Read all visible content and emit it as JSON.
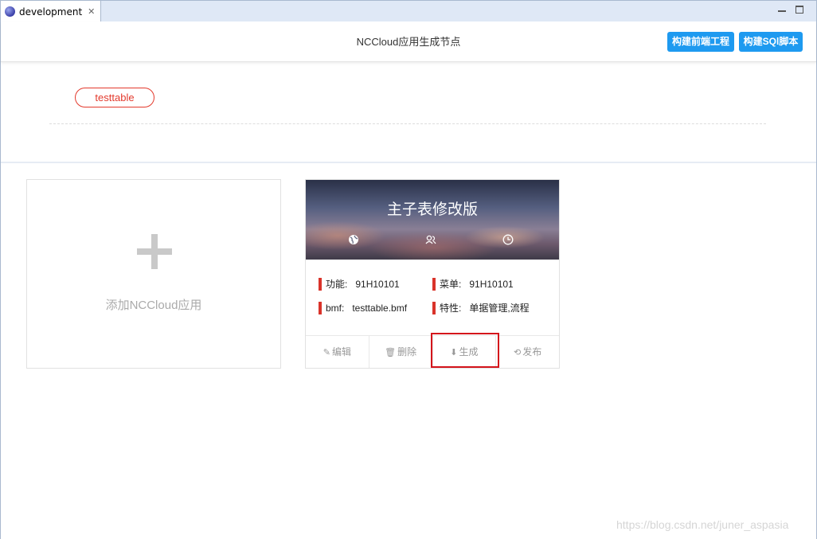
{
  "window": {
    "tab_label": "development",
    "tab_icon": "eclipse-icon",
    "close_glyph": "✕"
  },
  "header": {
    "title": "NCCloud应用生成节点",
    "build_frontend_label": "构建前端工程",
    "build_sql_label": "构建SQl脚本"
  },
  "tags": [
    {
      "label": "testtable",
      "color": "#e33a2d"
    }
  ],
  "add_card": {
    "label": "添加NCCloud应用"
  },
  "app_card": {
    "title": "主子表修改版",
    "banner_icons": [
      "globe-icon",
      "users-icon",
      "clock-icon"
    ],
    "fields": {
      "function_key": "功能:",
      "function_value": "91H10101",
      "menu_key": "菜单:",
      "menu_value": "91H10101",
      "bmf_key": "bmf:",
      "bmf_value": "testtable.bmf",
      "feature_key": "特性:",
      "feature_value": "单据管理,流程"
    },
    "actions": {
      "edit": "编辑",
      "delete": "删除",
      "generate": "生成",
      "publish": "发布"
    }
  },
  "watermark": "https://blog.csdn.net/juner_aspasia",
  "colors": {
    "accent_blue": "#1e9af0",
    "accent_red": "#d9332a",
    "highlight_red": "#d4141b"
  }
}
